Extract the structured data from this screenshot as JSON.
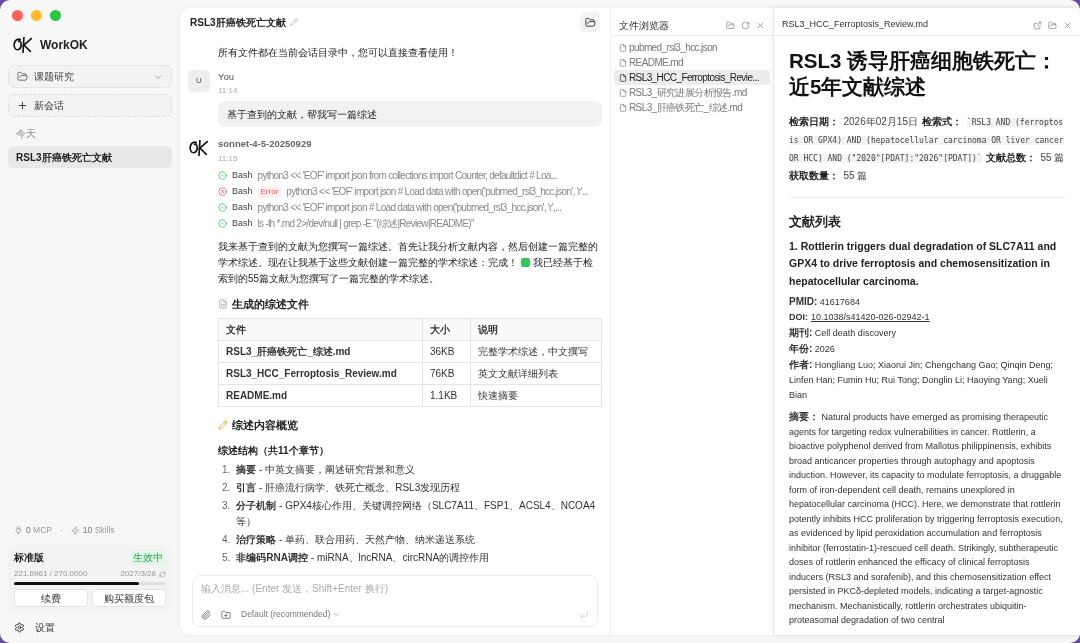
{
  "sidebar": {
    "app_name": "WorkOK",
    "project": "课题研究",
    "new_chat": "新会话",
    "section": "今天",
    "chats": [
      {
        "title": "RSL3肝癌铁死亡文献",
        "selected": true
      }
    ],
    "mcp": {
      "count": "0",
      "label": "MCP"
    },
    "separator": "·",
    "skills": {
      "count": "10",
      "label": "Skills"
    },
    "plan": {
      "name": "标准版",
      "status": "生效中",
      "usage": "221.6961 / 270.0000",
      "expires": "2027/3/28",
      "level": 0.82,
      "buttons": [
        "续费",
        "购买额度包"
      ]
    },
    "settings": "设置"
  },
  "chat": {
    "title": "RSL3肝癌铁死亡文献",
    "intro": "所有文件都在当前会话目录中，您可以直接查看使用！",
    "messages": [
      {
        "kind": "user",
        "avatar": "U",
        "author": "You",
        "time": "11:14",
        "text": "基于查到的文献，帮我写一篇综述"
      },
      {
        "kind": "assistant",
        "author": "sonnet-4-5-20250929",
        "time": "11:15",
        "tools": [
          {
            "name": "Bash",
            "failed": false,
            "command": "python3 << 'EOF' import json from collections import Counter, defaultdict # Loa..."
          },
          {
            "name": "Bash",
            "failed": true,
            "badge": "Error",
            "command": "python3 << 'EOF' import json # Load data with open('pubmed_rsl3_hcc.json', 'r'..."
          },
          {
            "name": "Bash",
            "failed": false,
            "command": "python3 << 'EOF' import json # Load data with open('pubmed_rsl3_hcc.json', 'r',..."
          },
          {
            "name": "Bash",
            "failed": false,
            "command": "ls -lh *.md 2>/dev/null | grep -E \"(综述|Review|README)\""
          }
        ],
        "text_before": "我来基于查到的文献为您撰写一篇综述。首先让我分析文献内容，然后创建一篇完整的学术综述。现在让我基于这些文献创建一篇完整的学术综述：完成！",
        "text_after": "我已经基于检索到的55篇文献为您撰写了一篇完整的学术综述。",
        "files_heading": "生成的综述文件",
        "table": {
          "columns": [
            "文件",
            "大小",
            "说明"
          ],
          "rows": [
            [
              "RSL3_肝癌铁死亡_综述.md",
              "36KB",
              "完整学术综述，中文撰写"
            ],
            [
              "RSL3_HCC_Ferroptosis_Review.md",
              "76KB",
              "英文文献详细列表"
            ],
            [
              "README.md",
              "1.1KB",
              "快速摘要"
            ]
          ]
        },
        "overview_heading": "综述内容概览",
        "structure_heading": "综述结构（共11个章节）",
        "sections": [
          {
            "number": "1.",
            "text": "**摘要** - 中英文摘要，阐述研究背景和意义"
          },
          {
            "number": "2.",
            "text": "**引言** - 肝癌流行病学、铁死亡概念、RSL3发现历程"
          },
          {
            "number": "3.",
            "text": "**分子机制** - GPX4核心作用、关键调控网络（SLC7A11、FSP1、ACSL4、NCOA4等）"
          },
          {
            "number": "4.",
            "text": "**治疗策略** - 单药、联合用药、天然产物、纳米递送系统"
          },
          {
            "number": "5.",
            "text": "**非编码RNA调控** - miRNA、lncRNA、circRNA的调控作用"
          }
        ]
      }
    ],
    "input": {
      "placeholder": "输入消息... (Enter 发送，Shift+Enter 换行)",
      "model": "Default (recommended)"
    }
  },
  "file_browser": {
    "title": "文件浏览器",
    "files": [
      {
        "name": "pubmed_rsl3_hcc.json",
        "selected": false
      },
      {
        "name": "README.md",
        "selected": false
      },
      {
        "name": "RSL3_HCC_Ferroptosis_Revie...",
        "selected": true
      },
      {
        "name": "RSL3_研究进展分析报告.md",
        "selected": false
      },
      {
        "name": "RSL3_肝癌铁死亡_综述.md",
        "selected": false
      }
    ]
  },
  "preview": {
    "filename": "RSL3_HCC_Ferroptosis_Review.md",
    "title": "RSL3 诱导肝癌细胞铁死亡：近5年文献综述",
    "meta": [
      {
        "kind": "bold",
        "text": "检索日期："
      },
      {
        "kind": "plain",
        "text": "2026年02月15日"
      },
      {
        "kind": "bold",
        "text": "检索式："
      },
      {
        "kind": "code",
        "text": "`RSL3 AND (ferroptosis OR GPX4) AND (hepatocellular carcinoma OR liver cancer OR HCC) AND (\"2020\"[PDAT]:\"2026\"[PDAT])`"
      },
      {
        "kind": "bold",
        "text": "文献总数："
      },
      {
        "kind": "plain",
        "text": "55 篇"
      },
      {
        "kind": "bold",
        "text": "获取数量："
      },
      {
        "kind": "plain",
        "text": "55 篇"
      }
    ],
    "list_heading": "文献列表",
    "article": {
      "title": "1. Rottlerin triggers dual degradation of SLC7A11 and GPX4 to drive ferroptosis and chemosensitization in hepatocellular carcinoma.",
      "pmid": "**PMID:** 41617684",
      "doi_label": "DOI:",
      "doi": "10.1038/s41420-026-02942-1",
      "journal": "**期刊:** Cell death discovery",
      "year": "**年份:** 2026",
      "authors": "**作者:** Hongliang Luo; Xiaorui Jin; Chengchang Gao; Qinqin Deng; Linfen Han; Fumin Hu; Rui Tong; Donglin Li; Haoying Yang; Xueli Bian",
      "abstract": "**摘要：** Natural products have emerged as promising therapeutic agents for targeting redox vulnerabilities in cancer. Rottlerin, a bioactive polyphenol derived from Mallotus philippinensis, exhibits broad anticancer properties through autophagy and apoptosis induction. However, its capacity to modulate ferroptosis, a druggable form of iron-dependent cell death, remains unexplored in hepatocellular carcinoma (HCC). Here, we demonstrate that rottlerin potently inhibits HCC proliferation by triggering ferroptosis execution, as evidenced by lipid peroxidation accumulation and ferroptosis inhibitor (ferrostatin-1)-rescued cell death. Strikingly, subtherapeutic doses of rottlerin enhanced the efficacy of clinical ferroptosis inducers (RSL3 and sorafenib), and this chemosensitization effect persisted in PKCδ-depleted models, indicating a target-agnostic mechanism. Mechanistically, rottlerin orchestrates ubiquitin-proteasomal degradation of two central"
    }
  }
}
